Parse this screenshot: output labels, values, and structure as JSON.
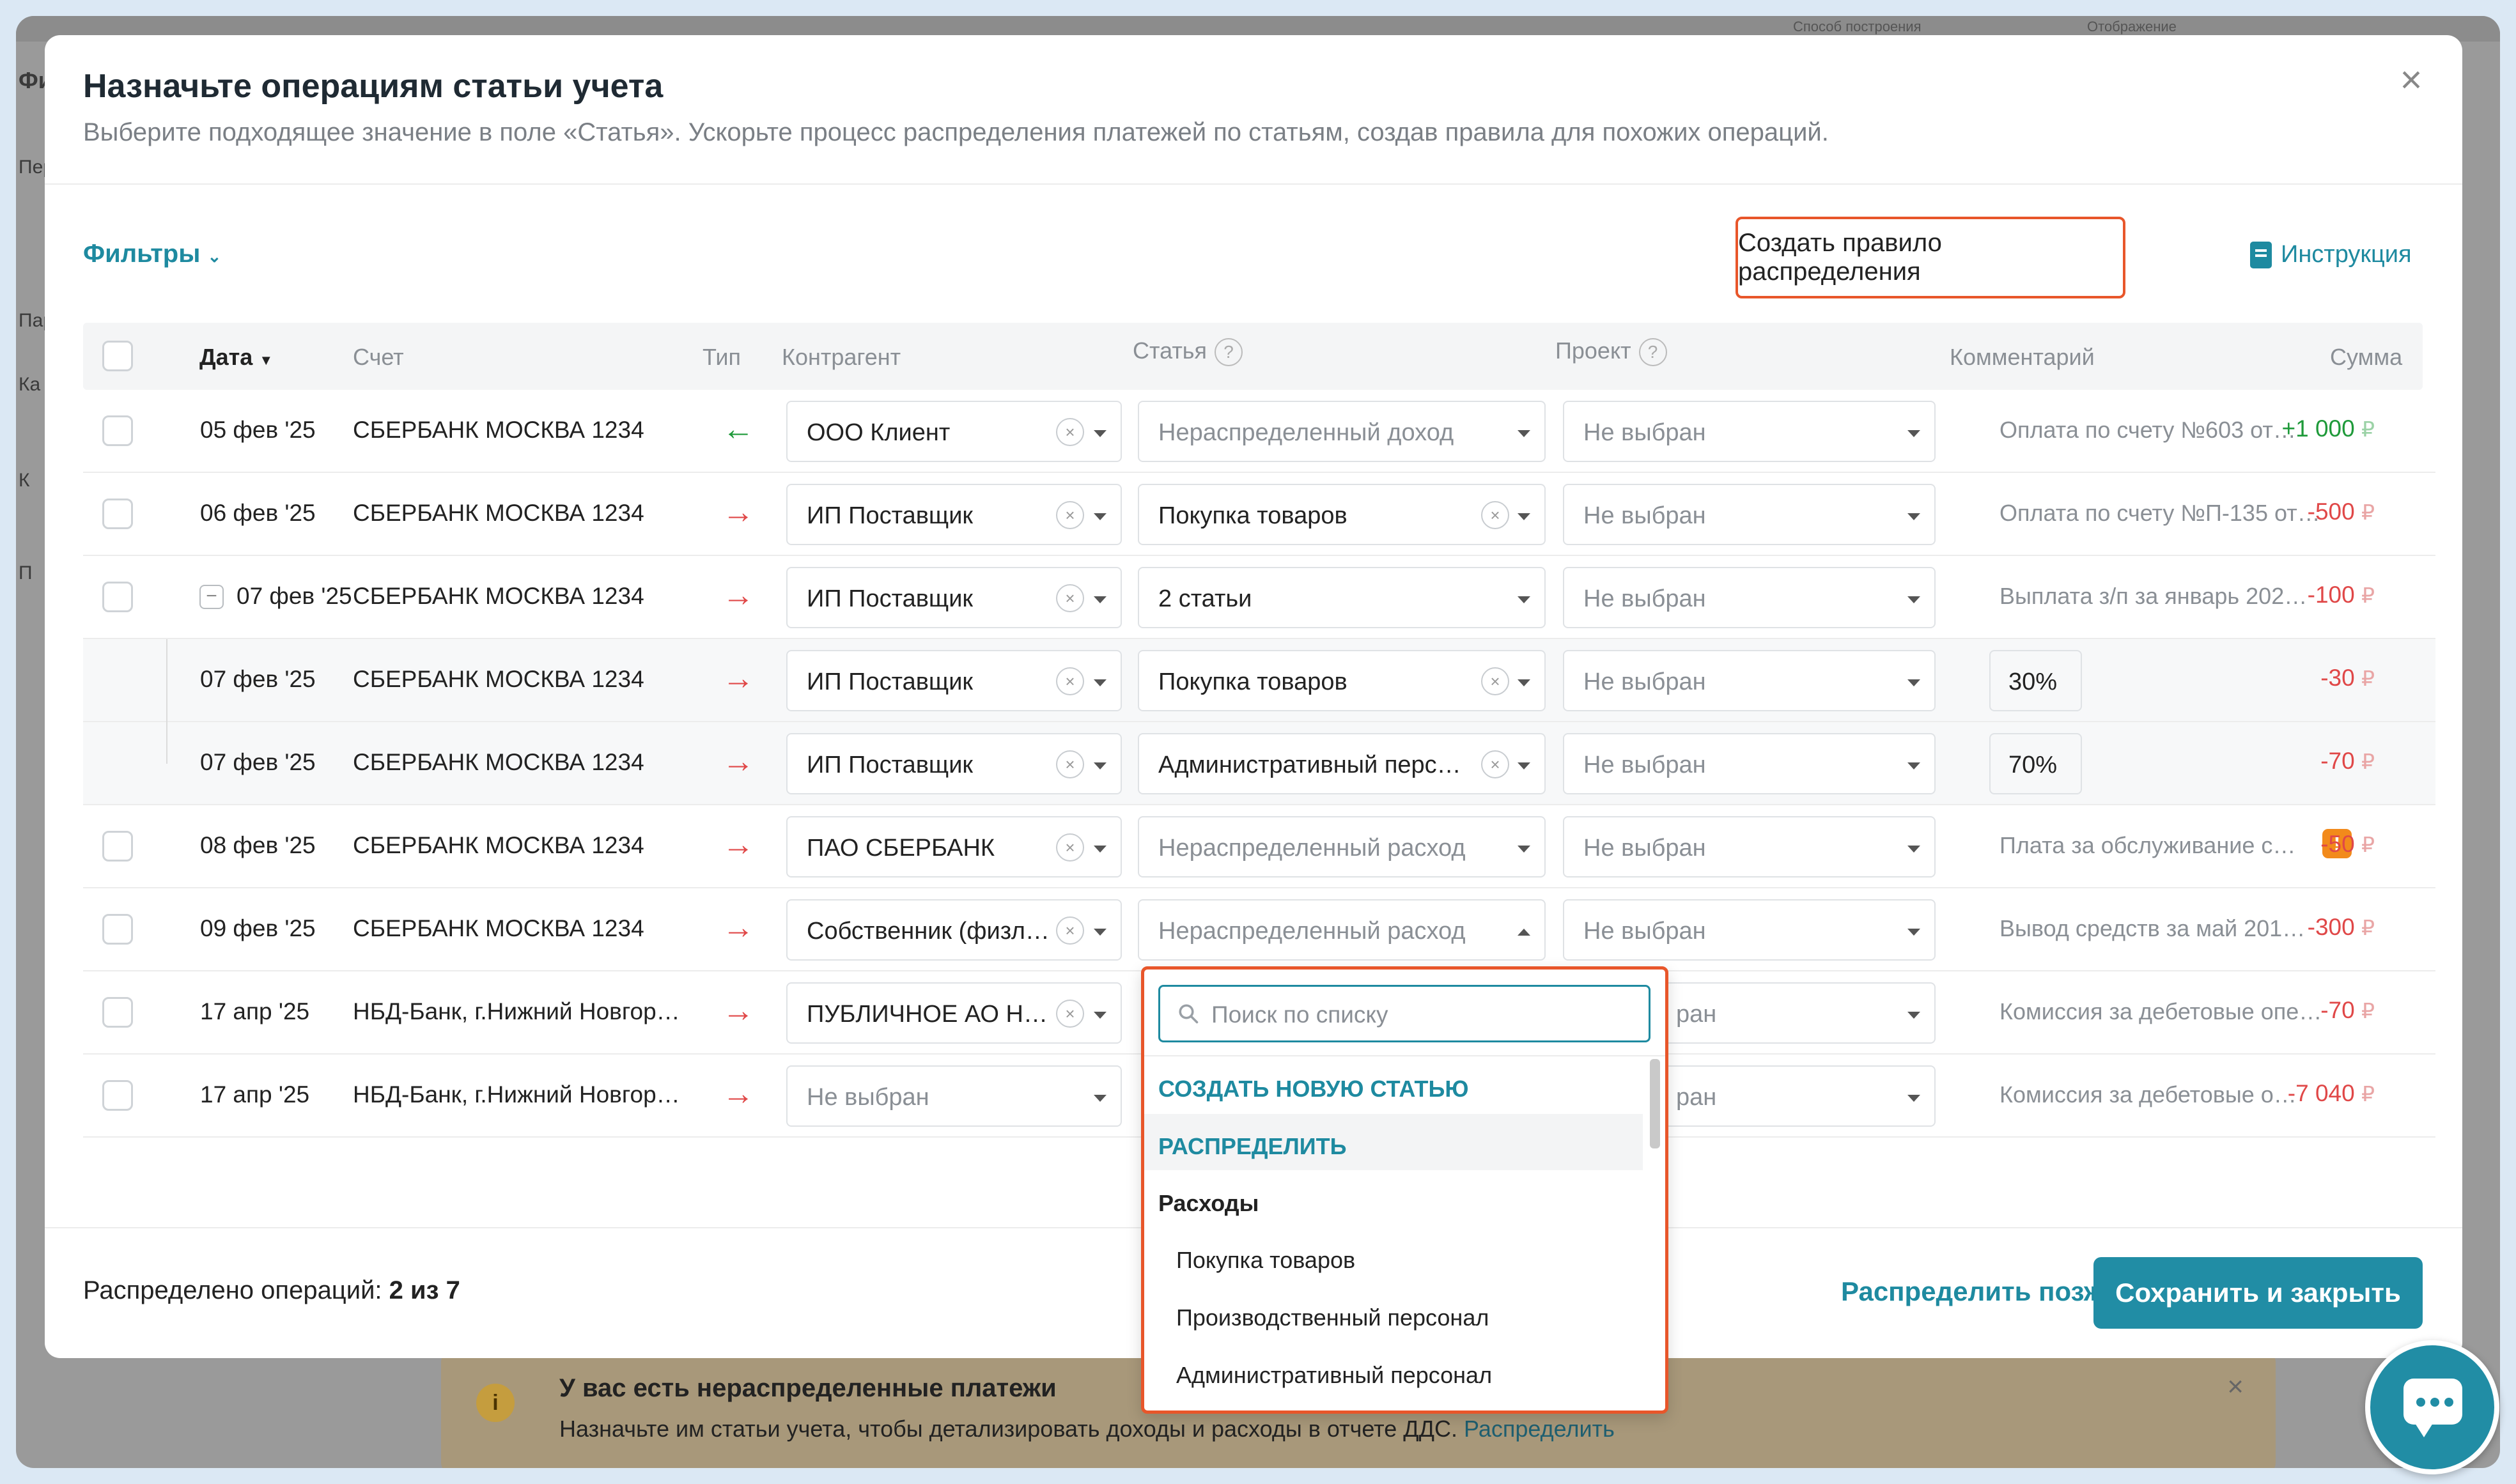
{
  "background": {
    "top_labels": [
      "Способ построения",
      "Отображение"
    ],
    "left_fragments": [
      "Фи",
      "Пер",
      "Пар",
      "Ка",
      "К",
      "П"
    ],
    "banner": {
      "title": "У вас есть нераспределенные платежи",
      "text": "Назначьте им статьи учета, чтобы детализировать доходы и расходы в отчете ДДС.",
      "link": "Распределить"
    }
  },
  "modal": {
    "title": "Назначьте операциям статьи учета",
    "subtitle": "Выберите подходящее значение в поле «Статья». Ускорьте процесс распределения платежей по статьям, создав правила для похожих операций.",
    "filters_label": "Фильтры",
    "create_rule_label": "Создать правило распределения",
    "instruction_label": "Инструкция",
    "columns": {
      "date": "Дата",
      "account": "Счет",
      "type": "Тип",
      "counterparty": "Контрагент",
      "article": "Статья",
      "project": "Проект",
      "comment": "Комментарий",
      "sum": "Сумма"
    },
    "rows": [
      {
        "date": "05 фев '25",
        "account": "СБЕРБАНК МОСКВА 1234",
        "type": "in",
        "counterparty": "ООО Клиент",
        "article": "Нераспределенный доход",
        "article_placeholder": true,
        "project": "Не выбран",
        "comment": "Оплата по счету №603 от…",
        "sum": "+1 000",
        "currency": "₽"
      },
      {
        "date": "06 фев '25",
        "account": "СБЕРБАНК МОСКВА 1234",
        "type": "out",
        "counterparty": "ИП Поставщик",
        "article": "Покупка товаров",
        "article_placeholder": false,
        "project": "Не выбран",
        "comment": "Оплата по счету №П-135 от…",
        "sum": "-500",
        "currency": "₽"
      },
      {
        "date": "07 фев '25",
        "account": "СБЕРБАНК МОСКВА 1234",
        "type": "out",
        "counterparty": "ИП Поставщик",
        "article": "2 статьи",
        "article_placeholder": false,
        "project": "Не выбран",
        "comment": "Выплата з/п за январь 202…",
        "sum": "-100",
        "currency": "₽",
        "expanded": true
      },
      {
        "date": "07 фев '25",
        "account": "СБЕРБАНК МОСКВА 1234",
        "type": "out",
        "counterparty": "ИП Поставщик",
        "article": "Покупка товаров",
        "article_placeholder": false,
        "project": "Не выбран",
        "percent": "30%",
        "sum": "-30",
        "currency": "₽",
        "sub": true
      },
      {
        "date": "07 фев '25",
        "account": "СБЕРБАНК МОСКВА 1234",
        "type": "out",
        "counterparty": "ИП Поставщик",
        "article": "Административный перс…",
        "article_placeholder": false,
        "project": "Не выбран",
        "percent": "70%",
        "sum": "-70",
        "currency": "₽",
        "sub": true
      },
      {
        "date": "08 фев '25",
        "account": "СБЕРБАНК МОСКВА 1234",
        "type": "out",
        "counterparty": "ПАО СБЕРБАНК",
        "article": "Нераспределенный расход",
        "article_placeholder": true,
        "project": "Не выбран",
        "comment": "Плата за обслуживание с…",
        "sum": "-50",
        "currency": "₽",
        "warning": "!"
      },
      {
        "date": "09 фев '25",
        "account": "СБЕРБАНК МОСКВА 1234",
        "type": "out",
        "counterparty": "Собственник (физл…",
        "article": "Нераспределенный расход",
        "article_placeholder": true,
        "project": "Не выбран",
        "comment": "Вывод средств за май 201…",
        "sum": "-300",
        "currency": "₽",
        "open": true
      },
      {
        "date": "17 апр '25",
        "account": "НБД-Банк, г.Нижний Новгор…",
        "type": "out",
        "counterparty": "ПУБЛИЧНОЕ АО Н…",
        "project": "ран",
        "comment": "Комиссия за дебетовые опе…",
        "sum": "-70",
        "currency": "₽"
      },
      {
        "date": "17 апр '25",
        "account": "НБД-Банк, г.Нижний Новгор…",
        "type": "out",
        "counterparty": "Не выбран",
        "counterparty_placeholder": true,
        "project": "ран",
        "comment": "Комиссия за дебетовые о…",
        "sum": "-7 040",
        "currency": "₽"
      }
    ],
    "dropdown": {
      "search_placeholder": "Поиск по списку",
      "create_new": "СОЗДАТЬ НОВУЮ СТАТЬЮ",
      "distribute": "РАСПРЕДЕЛИТЬ",
      "group": "Расходы",
      "options": [
        "Покупка товаров",
        "Производственный персонал",
        "Административный персонал"
      ]
    },
    "footer": {
      "distributed_label": "Распределено операций:",
      "distributed_value": "2 из 7",
      "later_label": "Распределить позже",
      "save_label": "Сохранить и закрыть"
    }
  },
  "icons": {
    "in_arrow": "←",
    "out_arrow": "→",
    "close": "×",
    "clear": "×",
    "minus": "−",
    "help": "?"
  },
  "colors": {
    "accent": "#1e8aa0",
    "highlight": "#e8562a",
    "positive": "#1f9a3a",
    "negative": "#e04848",
    "warning": "#f28a1b"
  }
}
